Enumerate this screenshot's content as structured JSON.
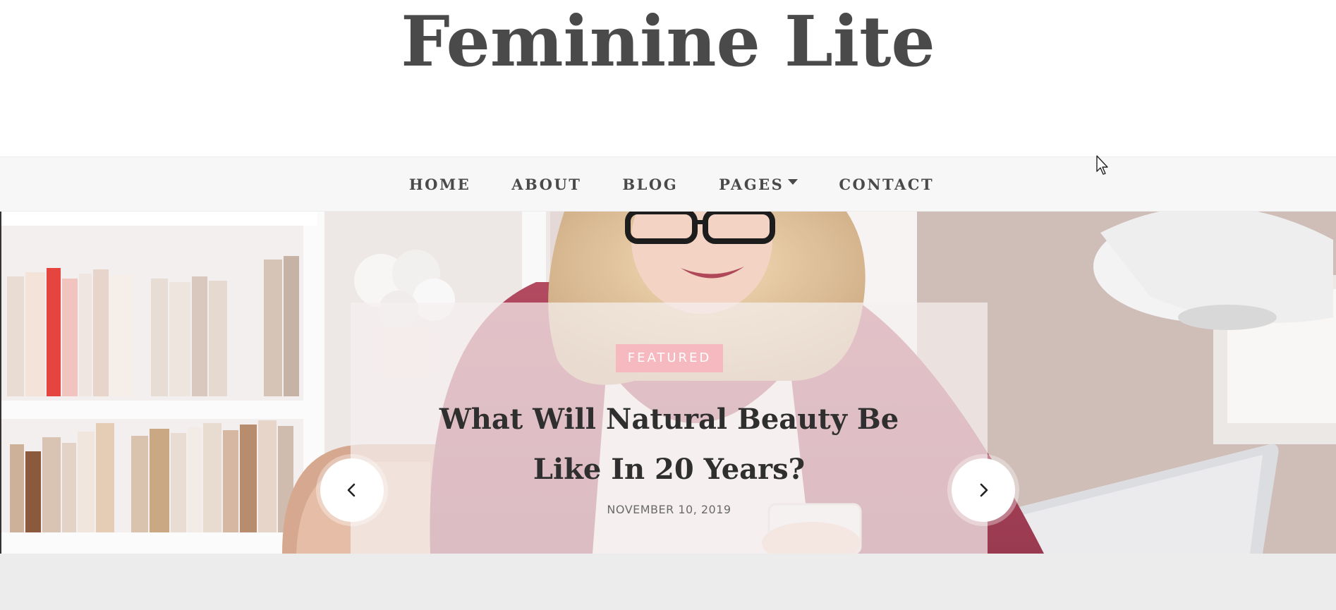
{
  "site": {
    "title": "Feminine Lite"
  },
  "nav": {
    "items": [
      {
        "label": "HOME"
      },
      {
        "label": "ABOUT"
      },
      {
        "label": "BLOG"
      },
      {
        "label": "PAGES",
        "has_dropdown": true
      },
      {
        "label": "CONTACT"
      }
    ]
  },
  "slider": {
    "category": "FEATURED",
    "title": "What Will Natural Beauty Be Like In 20 Years?",
    "date": "NOVEMBER 10, 2019",
    "prev_icon": "chevron-left-icon",
    "next_icon": "chevron-right-icon"
  },
  "colors": {
    "title_text": "#4a4a4a",
    "nav_background": "#f7f7f7",
    "badge_background": "#f7b9c0",
    "card_background": "rgba(245,240,240,0.72)",
    "footer_band": "#ececec"
  }
}
